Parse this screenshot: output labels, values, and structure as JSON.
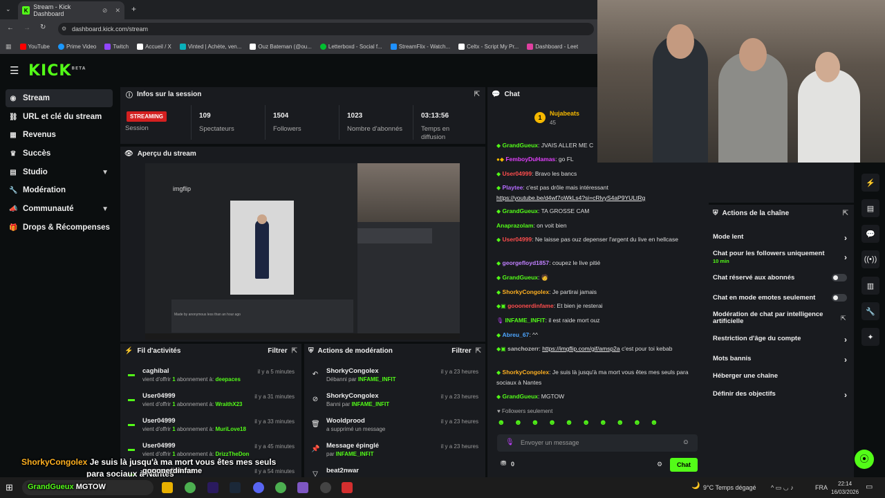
{
  "browser": {
    "tab_title": "Stream - Kick Dashboard",
    "url": "dashboard.kick.com/stream",
    "bookmarks": [
      {
        "label": "YouTube",
        "color": "#ff0000"
      },
      {
        "label": "Prime Video",
        "color": "#1a98ff"
      },
      {
        "label": "Twitch",
        "color": "#9146ff"
      },
      {
        "label": "Accueil / X",
        "color": "#ffffff"
      },
      {
        "label": "Vinted | Achète, ven...",
        "color": "#09b1ba"
      },
      {
        "label": "Ouz Bateman (@ou...",
        "color": "#ffffff"
      },
      {
        "label": "Letterboxd - Social f...",
        "color": "#00c030"
      },
      {
        "label": "StreamFlix - Watch...",
        "color": "#1e90ff"
      },
      {
        "label": "Celtx - Script My Pr...",
        "color": "#ffffff"
      },
      {
        "label": "Dashboard - Leet",
        "color": "#e040a0"
      }
    ]
  },
  "sidebar": {
    "items": [
      {
        "label": "Stream",
        "icon": "broadcast-icon"
      },
      {
        "label": "URL et clé du stream",
        "icon": "link-icon"
      },
      {
        "label": "Revenus",
        "icon": "revenue-icon"
      },
      {
        "label": "Succès",
        "icon": "trophy-icon"
      },
      {
        "label": "Studio",
        "icon": "studio-icon"
      },
      {
        "label": "Modération",
        "icon": "wrench-icon"
      },
      {
        "label": "Communauté",
        "icon": "megaphone-icon"
      },
      {
        "label": "Drops & Récompenses",
        "icon": "gift-icon"
      }
    ]
  },
  "session": {
    "title": "Infos sur la session",
    "status": "STREAMING",
    "status_label": "Session",
    "viewers": "109",
    "viewers_label": "Spectateurs",
    "followers": "1504",
    "followers_label": "Followers",
    "subs": "1023",
    "subs_label": "Nombre d'abonnés",
    "uptime": "03:13:56",
    "uptime_label": "Temps en diffusion"
  },
  "preview": {
    "title": "Aperçu du stream",
    "inner_url": "imgflip",
    "inner_caption": "Made by anonymous  less than an hour ago"
  },
  "activity": {
    "title": "Fil d'activités",
    "filter": "Filtrer",
    "items": [
      {
        "name": "caghibal",
        "pre": "vient d'offrir",
        "count": "1",
        "mid": "abonnement à:",
        "target": "deepaces",
        "time": "il y a 5 minutes"
      },
      {
        "name": "User04999",
        "pre": "vient d'offrir",
        "count": "1",
        "mid": "abonnement à:",
        "target": "WraithX23",
        "time": "il y a 31 minutes"
      },
      {
        "name": "User04999",
        "pre": "vient d'offrir",
        "count": "1",
        "mid": "abonnement à:",
        "target": "MuriLove18",
        "time": "il y a 33 minutes"
      },
      {
        "name": "User04999",
        "pre": "vient d'offrir",
        "count": "1",
        "mid": "abonnement à:",
        "target": "DrizzTheDon",
        "time": "il y a 45 minutes"
      },
      {
        "name": "gooonerdinfame",
        "pre": "",
        "count": "",
        "mid": "",
        "target": "",
        "time": "il y a 54 minutes"
      }
    ]
  },
  "moderation": {
    "title": "Actions de modération",
    "filter": "Filtrer",
    "items": [
      {
        "name": "ShorkyCongolex",
        "action": "Débanni par",
        "by": "INFAME_INFIT",
        "time": "il y a 23 heures",
        "icon": "undo-icon"
      },
      {
        "name": "ShorkyCongolex",
        "action": "Banni par",
        "by": "INFAME_INFIT",
        "time": "il y a 23 heures",
        "icon": "ban-icon"
      },
      {
        "name": "Wooldprood",
        "action": "a supprimé un message",
        "by": "",
        "time": "il y a 23 heures",
        "icon": "trash-icon"
      },
      {
        "name": "Message épinglé",
        "action": "par",
        "by": "INFAME_INFIT",
        "time": "il y a 23 heures",
        "icon": "pin-icon"
      },
      {
        "name": "beat2nwar",
        "action": "",
        "by": "",
        "time": "",
        "icon": "filter-icon"
      }
    ]
  },
  "chat": {
    "title": "Chat",
    "pinned_user": "Nujabeats",
    "pinned_count": "45",
    "messages": [
      {
        "user": "GrandGueux",
        "color": "#53fc18",
        "text": "JVAIS ALLER ME C"
      },
      {
        "user": "FemboyDuHamas",
        "color": "#e040fb",
        "text": "go FL"
      },
      {
        "user": "User04999",
        "color": "#ff4d4d",
        "text": "Bravo les bancs"
      },
      {
        "user": "Playtee",
        "color": "#b56cff",
        "text": "c'est pas drôle mais intéressant",
        "link": "https://youtube.be/d4wf7oWkLs4?si=cRlvyS4aP9YULtRg"
      },
      {
        "user": "GrandGueux",
        "color": "#53fc18",
        "text": "TA GROSSE CAM"
      },
      {
        "user": "Anaprazolam",
        "color": "#53fc18",
        "text": "on voit bien"
      },
      {
        "user": "User04999",
        "color": "#ff4d4d",
        "text": "Ne laisse pas ouz depenser l'argent du live en hellcase"
      },
      {
        "user": "georgefloyd1857",
        "color": "#c080ff",
        "text": "coupez le live pitié"
      },
      {
        "user": "GrandGueux",
        "color": "#53fc18",
        "text": ""
      },
      {
        "user": "ShorkyCongolex",
        "color": "#ffb020",
        "text": "Je partirai jamais"
      },
      {
        "user": "gooonerdinfame",
        "color": "#ff4d4d",
        "text": "Et bien je resterai"
      },
      {
        "user": "INFAME_INFIT",
        "color": "#53fc18",
        "text": "il est raide mort ouz"
      },
      {
        "user": "Abreu_67",
        "color": "#4da6ff",
        "text": "^^"
      },
      {
        "user": "sanchozerr",
        "color": "#bbbbbb",
        "text": "c'est pour toi kebab",
        "link": "https://imgflip.com/gif/amsp2a"
      },
      {
        "user": "ShorkyCongolex",
        "color": "#ffb020",
        "text": "Je suis là jusqu'à ma mort vous êtes mes seuls para sociaux à Nantes"
      },
      {
        "user": "GrandGueux",
        "color": "#53fc18",
        "text": "MGTOW"
      }
    ],
    "followers_only": "Followers seulement",
    "input_placeholder": "Envoyer un message",
    "send_label": "Chat",
    "points": "0"
  },
  "channel_actions": {
    "title": "Actions de la chaîne",
    "items": [
      {
        "label": "Mode lent",
        "type": "chevron"
      },
      {
        "label": "Chat pour les followers uniquement",
        "sub": "10 min",
        "type": "chevron"
      },
      {
        "label": "Chat réservé aux abonnés",
        "type": "toggle"
      },
      {
        "label": "Chat en mode emotes seulement",
        "type": "toggle"
      },
      {
        "label": "Modération de chat par intelligence artificielle",
        "type": "external"
      },
      {
        "label": "Restriction d'âge du compte",
        "type": "chevron"
      },
      {
        "label": "Mots bannis",
        "type": "chevron"
      },
      {
        "label": "Héberger une chaîne",
        "type": "none"
      },
      {
        "label": "Définir des objectifs",
        "type": "chevron"
      }
    ]
  },
  "overlay": {
    "line1_user": "ShorkyCongolex",
    "line1_text": "Je suis là jusqu'à ma mort vous êtes mes seuls",
    "line2_text": "para sociaux à Nantes",
    "line3_user": "GrandGueux",
    "line3_text": "MGTOW",
    "line3_extra": "gooonerdinfame"
  },
  "taskbar": {
    "weather": "9°C  Temps dégagé",
    "lang": "FRA",
    "time": "22:14",
    "date": "16/03/2026"
  }
}
